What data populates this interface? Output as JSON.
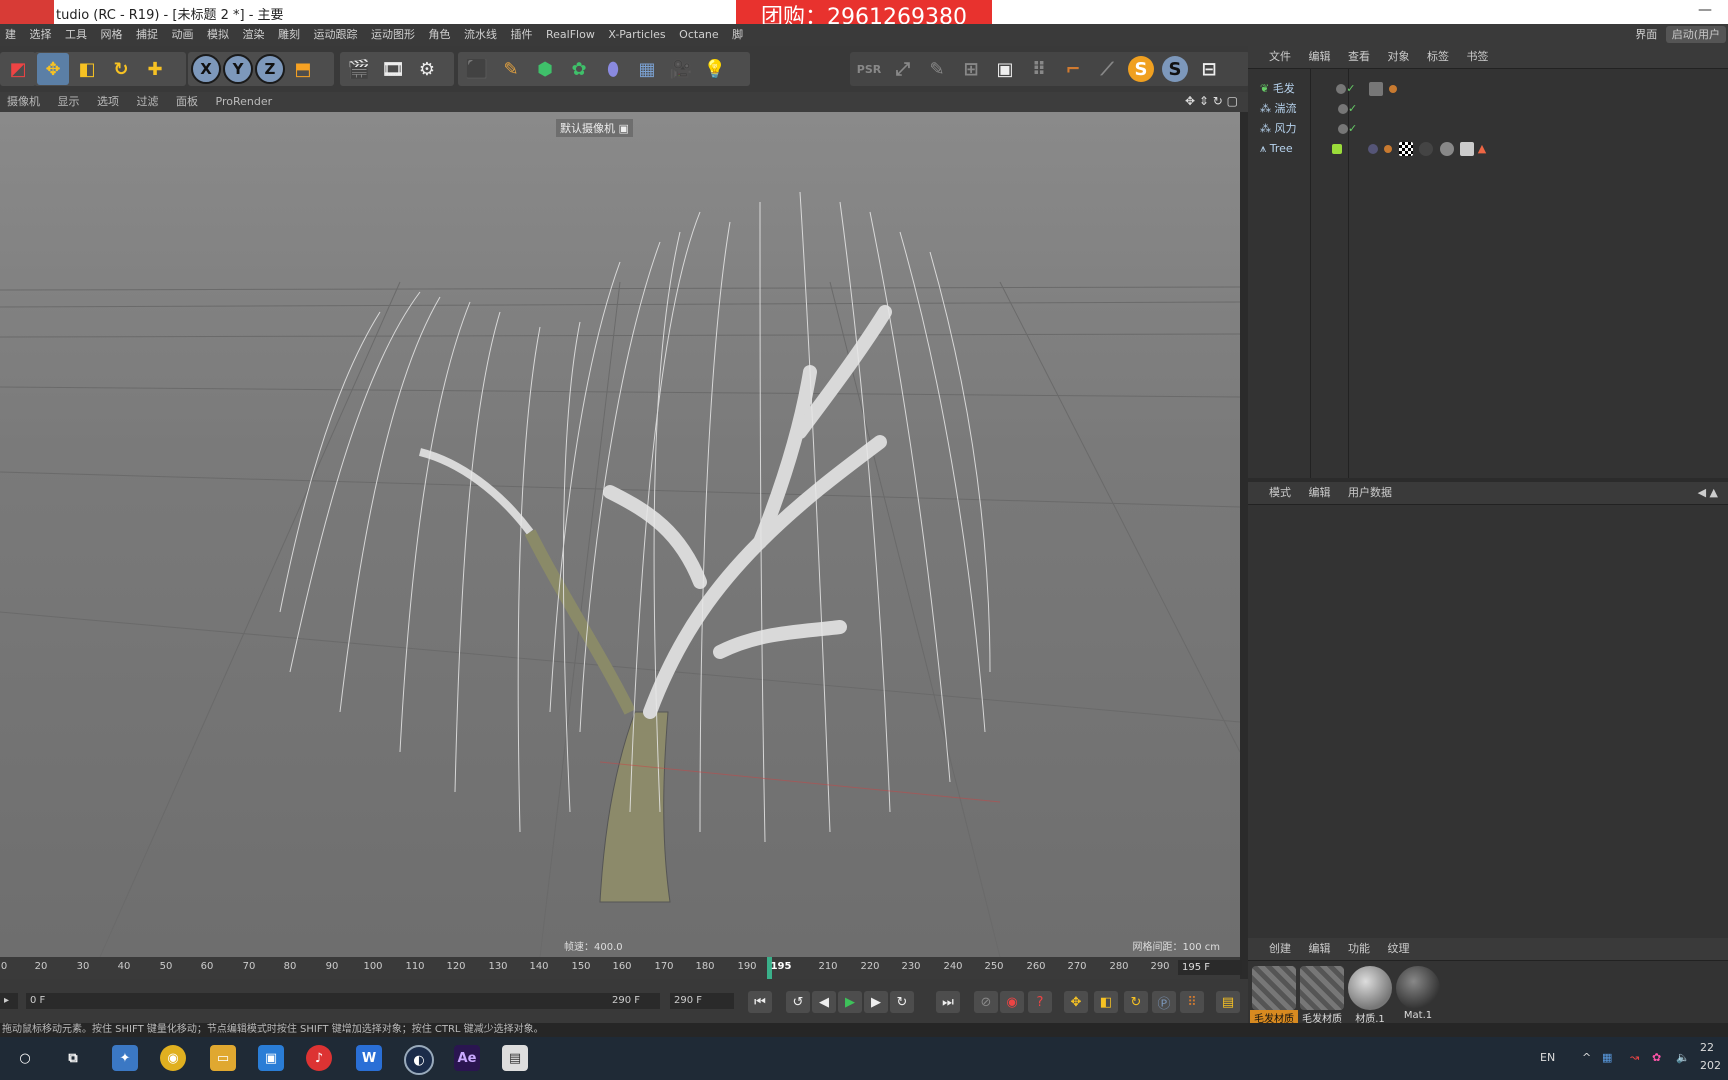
{
  "window": {
    "title": "tudio (RC - R19) - [未标题 2 *] - 主要",
    "minimize": "—"
  },
  "banner": {
    "text": "团购：2961269380"
  },
  "menubar": {
    "items": [
      "建",
      "选择",
      "工具",
      "网格",
      "捕捉",
      "动画",
      "模拟",
      "渲染",
      "雕刻",
      "运动跟踪",
      "运动图形",
      "角色",
      "流水线",
      "插件",
      "RealFlow",
      "X-Particles",
      "Octane",
      "脚"
    ],
    "right": [
      "界面",
      "启动(用户"
    ]
  },
  "toolbar": {
    "x_label": "X",
    "y_label": "Y",
    "z_label": "Z",
    "s1_label": "S",
    "s2_label": "S"
  },
  "viewport": {
    "menu": [
      "摄像机",
      "显示",
      "选项",
      "过滤",
      "面板",
      "ProRender"
    ],
    "camera": "默认摄像机",
    "camera_icon": "camera-icon",
    "speed": "帧速：400.0",
    "grid_spacing": "网格间距：100 cm"
  },
  "objects_panel": {
    "tabs": [
      "文件",
      "编辑",
      "查看",
      "对象",
      "标签",
      "书签"
    ],
    "rows": [
      {
        "name": "毛发",
        "color": "#8fd18f"
      },
      {
        "name": "湍流",
        "color": "#b7d3ee"
      },
      {
        "name": "风力",
        "color": "#b7d3ee"
      },
      {
        "name": "Tree",
        "color": "#b7d3ee"
      }
    ]
  },
  "attributes_panel": {
    "tabs": [
      "模式",
      "编辑",
      "用户数据"
    ]
  },
  "materials_panel": {
    "tabs": [
      "创建",
      "编辑",
      "功能",
      "纹理"
    ],
    "materials": [
      "毛发材质",
      "毛发材质",
      "材质.1",
      "Mat.1"
    ]
  },
  "timeline": {
    "ticks": [
      "0",
      "20",
      "30",
      "40",
      "50",
      "60",
      "70",
      "80",
      "90",
      "100",
      "110",
      "120",
      "130",
      "140",
      "150",
      "160",
      "170",
      "180",
      "190",
      "195",
      "210",
      "220",
      "230",
      "240",
      "250",
      "260",
      "270",
      "280",
      "290"
    ],
    "current_frame": "195 F"
  },
  "transport": {
    "start_field": "0 F",
    "end_field_left": "290 F",
    "end_field": "290 F"
  },
  "status": {
    "text": "拖动鼠标移动元素。按住 SHIFT 键量化移动；节点编辑模式时按住 SHIFT 键增加选择对象；按住 CTRL 键减少选择对象。"
  },
  "taskbar": {
    "apps": [
      "search-icon",
      "task-view-icon",
      "app-icon",
      "chrome-icon",
      "file-explorer-icon",
      "store-icon",
      "netease-music-icon",
      "wps-icon",
      "cinema4d-icon",
      "after-effects-icon",
      "notes-icon"
    ],
    "ae_label": "Ae",
    "tray_lang": "EN",
    "clock_time": "22",
    "clock_date": "202"
  },
  "colors": {
    "accent": "#5b7fa6",
    "banner": "#e8322e",
    "playhead": "#3ab08a"
  }
}
